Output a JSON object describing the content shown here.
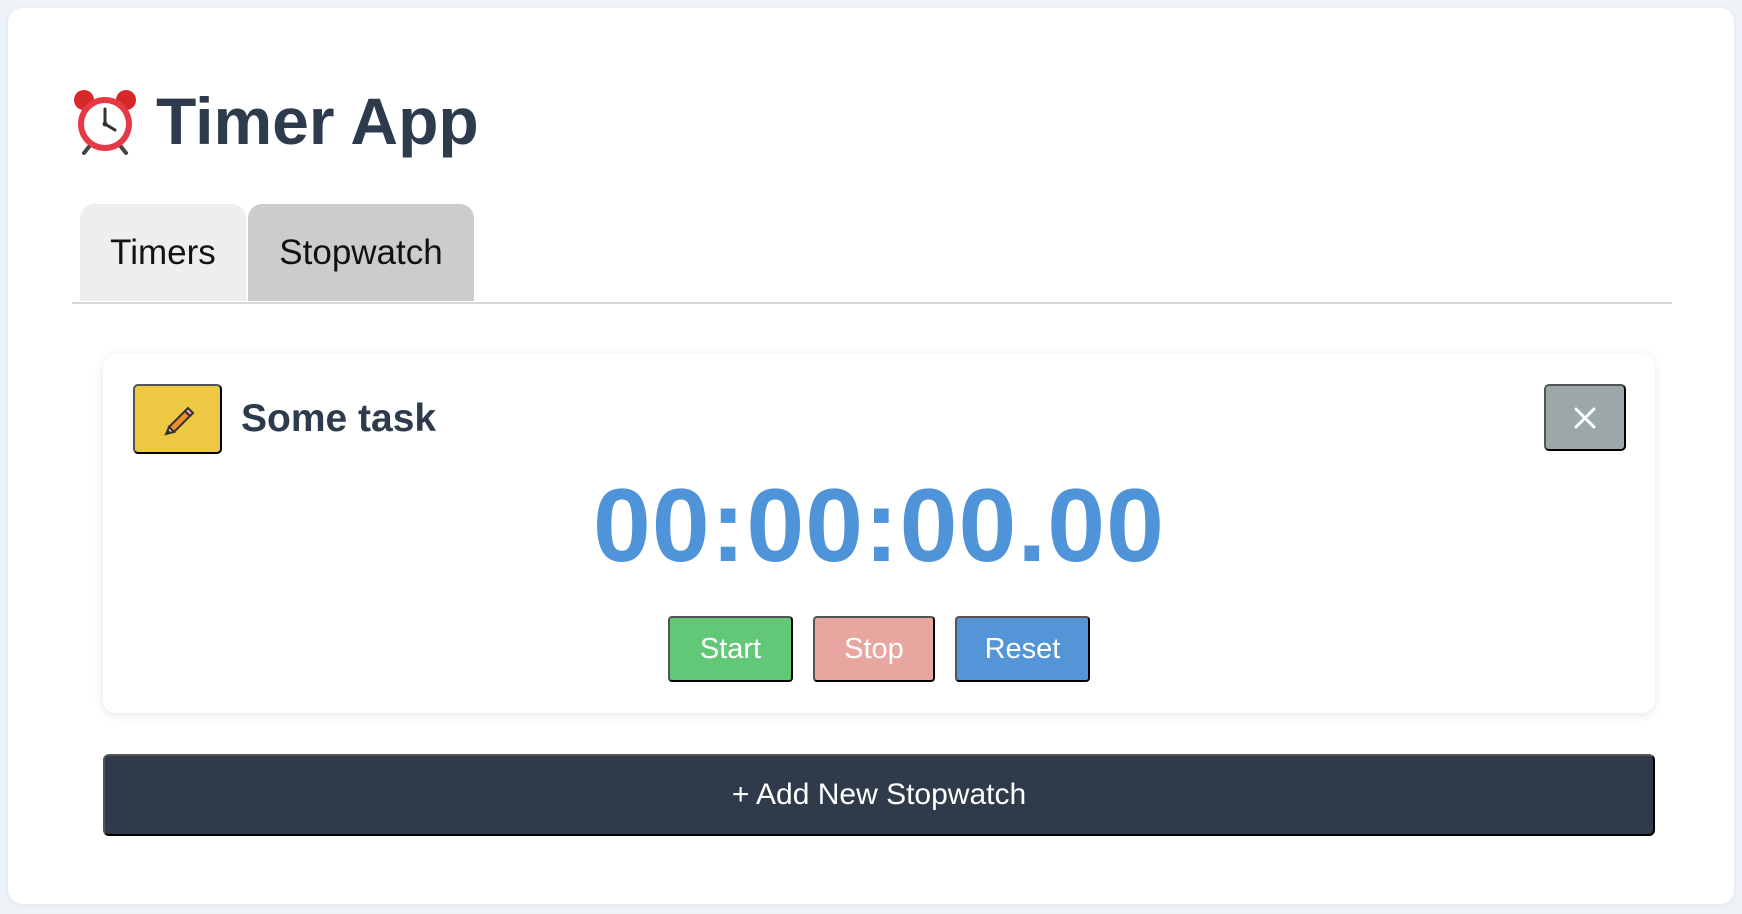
{
  "app": {
    "title": "Timer App",
    "icon": "alarm-clock-icon"
  },
  "tabs": [
    {
      "label": "Timers",
      "active": false
    },
    {
      "label": "Stopwatch",
      "active": true
    }
  ],
  "stopwatch": {
    "edit_icon": "pencil-icon",
    "task_name": "Some task",
    "close_icon": "close-icon",
    "time": "00:00:00.00",
    "buttons": {
      "start": "Start",
      "stop": "Stop",
      "reset": "Reset"
    }
  },
  "actions": {
    "add_stopwatch": "+ Add New Stopwatch"
  },
  "colors": {
    "panel_background": "#ffffff",
    "page_background": "#eef3f8",
    "heading_text": "#2e3b4c",
    "time_text": "#4f93d8",
    "edit_button": "#edc843",
    "close_button": "#9ba7a8",
    "start_button": "#62c878",
    "stop_button": "#e8a6a0",
    "reset_button": "#5495d8",
    "add_button": "#2f3b4a"
  }
}
